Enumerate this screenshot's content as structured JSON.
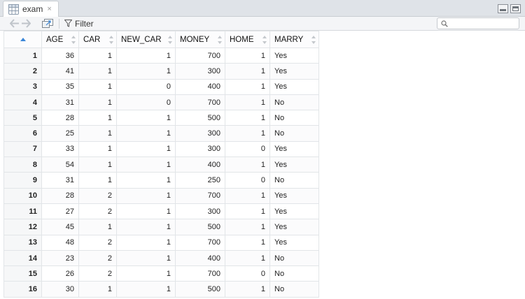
{
  "tab": {
    "title": "exam",
    "close": "×"
  },
  "toolbar": {
    "filter_label": "Filter",
    "search_placeholder": ""
  },
  "table": {
    "columns": [
      "AGE",
      "CAR",
      "NEW_CAR",
      "MONEY",
      "HOME",
      "MARRY"
    ],
    "rows": [
      [
        "1",
        "36",
        "1",
        "1",
        "700",
        "1",
        "Yes"
      ],
      [
        "2",
        "41",
        "1",
        "1",
        "300",
        "1",
        "Yes"
      ],
      [
        "3",
        "35",
        "1",
        "0",
        "400",
        "1",
        "Yes"
      ],
      [
        "4",
        "31",
        "1",
        "0",
        "700",
        "1",
        "No"
      ],
      [
        "5",
        "28",
        "1",
        "1",
        "500",
        "1",
        "No"
      ],
      [
        "6",
        "25",
        "1",
        "1",
        "300",
        "1",
        "No"
      ],
      [
        "7",
        "33",
        "1",
        "1",
        "300",
        "0",
        "Yes"
      ],
      [
        "8",
        "54",
        "1",
        "1",
        "400",
        "1",
        "Yes"
      ],
      [
        "9",
        "31",
        "1",
        "1",
        "250",
        "0",
        "No"
      ],
      [
        "10",
        "28",
        "2",
        "1",
        "700",
        "1",
        "Yes"
      ],
      [
        "11",
        "27",
        "2",
        "1",
        "300",
        "1",
        "Yes"
      ],
      [
        "12",
        "45",
        "1",
        "1",
        "500",
        "1",
        "Yes"
      ],
      [
        "13",
        "48",
        "2",
        "1",
        "700",
        "1",
        "Yes"
      ],
      [
        "14",
        "23",
        "2",
        "1",
        "400",
        "1",
        "No"
      ],
      [
        "15",
        "26",
        "2",
        "1",
        "700",
        "0",
        "No"
      ],
      [
        "16",
        "30",
        "1",
        "1",
        "500",
        "1",
        "No"
      ]
    ]
  },
  "colors": {
    "accent": "#3a86d8",
    "tab_bar": "#dfe3e8",
    "index_bg": "#f6f7f8"
  }
}
